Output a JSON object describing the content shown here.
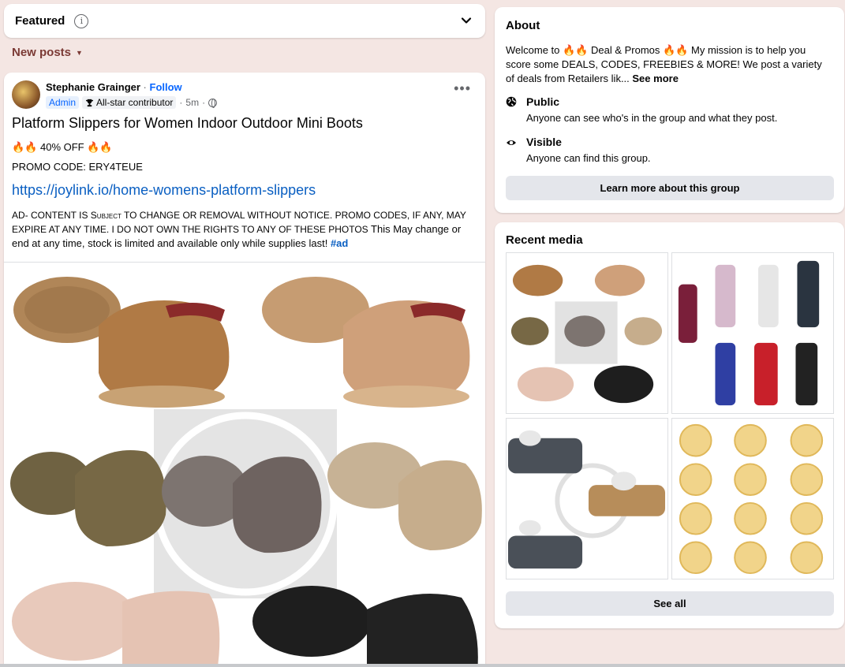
{
  "featured": {
    "title": "Featured",
    "info_icon": "info-icon",
    "chevron_icon": "chevron-down-icon"
  },
  "new_posts": {
    "label": "New posts",
    "caret_icon": "caret-down-icon"
  },
  "post": {
    "author": "Stephanie Grainger",
    "separator": "·",
    "follow": "Follow",
    "badge_admin": "Admin",
    "badge_contributor": "All-star contributor",
    "time": "5m",
    "dot": "·",
    "title": "Platform Slippers for Women Indoor Outdoor Mini Boots",
    "discount": "🔥🔥 40% OFF 🔥🔥",
    "promo_code": "PROMO CODE: ERY4TEUE",
    "link": "https://joylink.io/home-womens-platform-slippers",
    "disclaimer_caps": "AD- CONTENT IS Subject TO CHANGE OR REMOVAL WITHOUT NOTICE. PROMO CODES, IF ANY, MAY EXPIRE AT ANY TIME. I DO NOT OWN THE RIGHTS TO ANY OF THESE PHOTOS",
    "disclaimer_rest": " This May change or end at any time, stock is limited and available only while supplies last! ",
    "hashtag": "#ad",
    "more_icon": "more-options-icon"
  },
  "about": {
    "title": "About",
    "desc_start": "Welcome to 🔥🔥 Deal & Promos 🔥🔥 My mission is to help you score some DEALS, CODES, FREEBIES & MORE! We post a variety of deals from Retailers lik... ",
    "see_more": "See more",
    "public_title": "Public",
    "public_sub": "Anyone can see who's in the group and what they post.",
    "visible_title": "Visible",
    "visible_sub": "Anyone can find this group.",
    "learn_more": "Learn more about this group",
    "public_icon": "globe-icon",
    "visible_icon": "eye-icon"
  },
  "media": {
    "title": "Recent media",
    "see_all": "See all"
  },
  "colors": {
    "link": "#0a5fc2",
    "follow": "#0866ff",
    "bg": "#f4e6e3",
    "button": "#e4e6eb",
    "new_posts": "#7b3a35"
  }
}
